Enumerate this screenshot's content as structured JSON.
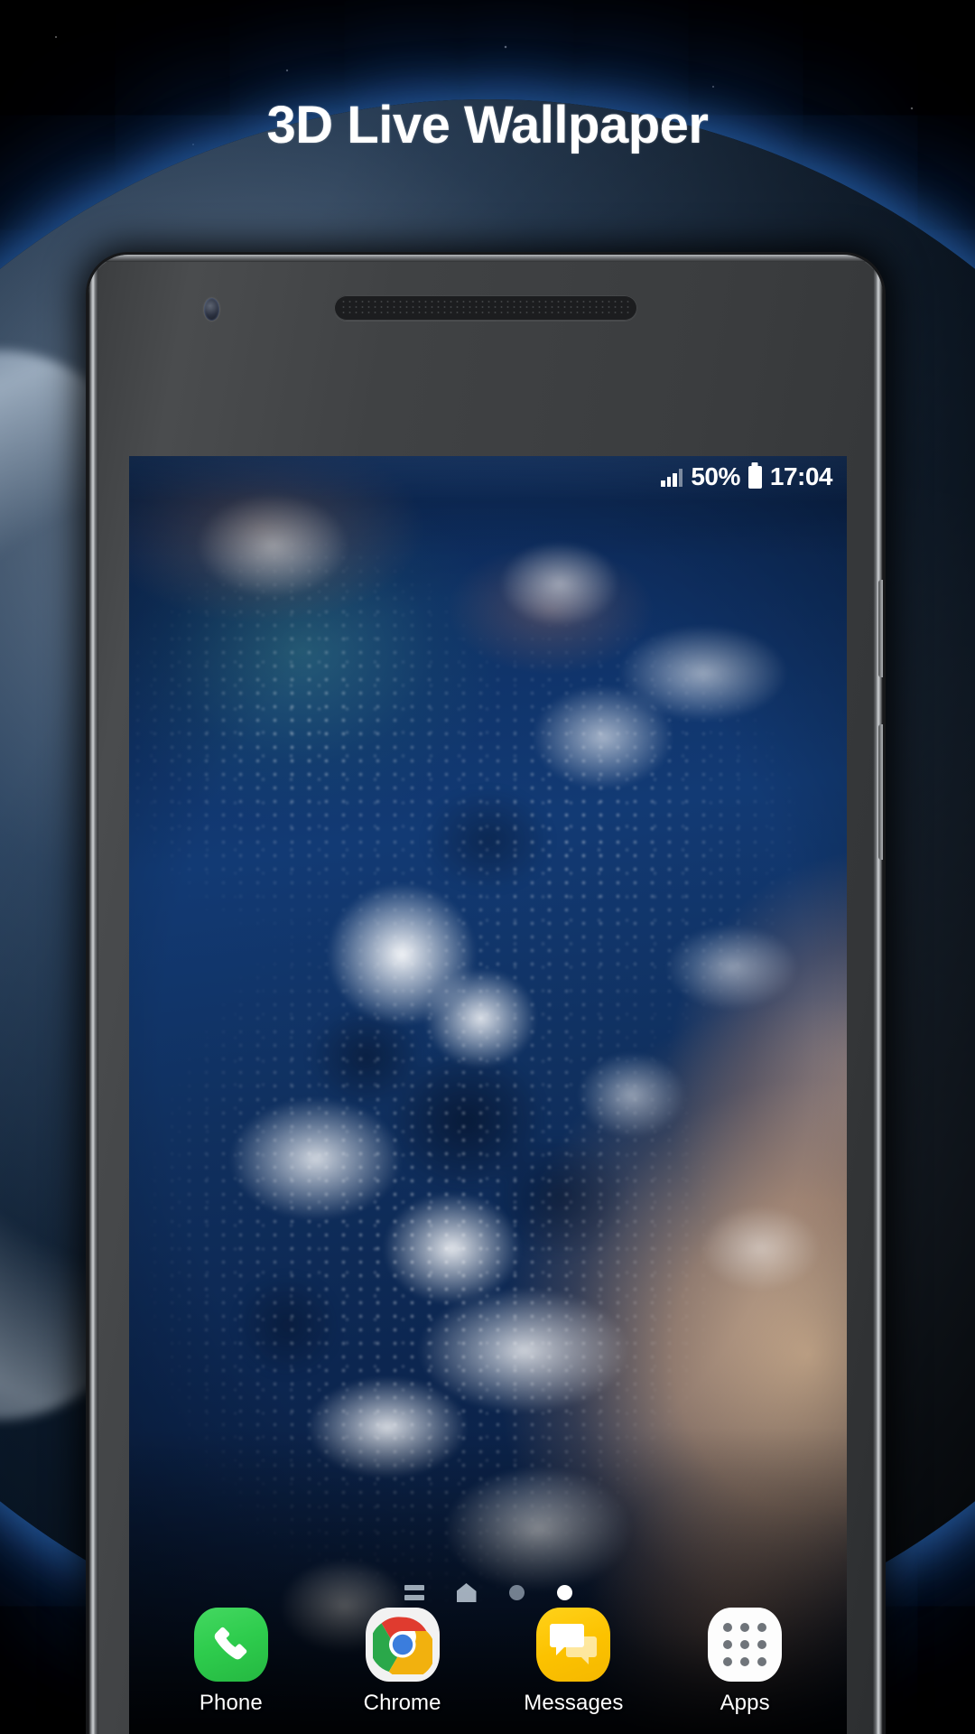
{
  "promo": {
    "headline": "3D Live Wallpaper",
    "background_scene": "earth-from-space",
    "colors": {
      "background": "#000000",
      "headline": "#ffffff",
      "atmosphere_glow": "#3c8ceb",
      "ocean": "#11356b",
      "landmass": "#dcba96"
    }
  },
  "device": {
    "type": "android-smartphone",
    "frame_color": "#3d3f41",
    "hardware": {
      "front_camera": "front-camera",
      "earpiece": "speaker-grill",
      "power_button": "power-button",
      "volume_button": "volume-button"
    }
  },
  "status_bar": {
    "signal_icon": "cellular-signal-icon",
    "signal_bars_filled": 3,
    "signal_bars_total": 4,
    "battery_percent": "50%",
    "battery_icon": "battery-icon",
    "time": "17:04"
  },
  "home_screen": {
    "wallpaper": "earth-live-wallpaper",
    "page_indicator": {
      "items": [
        {
          "name": "briefing-page-icon",
          "type": "briefing",
          "active": false
        },
        {
          "name": "home-page-icon",
          "type": "home",
          "active": false
        },
        {
          "name": "page-dot",
          "type": "dot",
          "active": false
        },
        {
          "name": "page-dot",
          "type": "dot",
          "active": true
        }
      ],
      "active_index": 3,
      "total_pages": 4
    },
    "dock": [
      {
        "label": "Phone",
        "icon": "phone-icon",
        "color": "#2ecc4d"
      },
      {
        "label": "Chrome",
        "icon": "chrome-icon",
        "color": "#f2f2f2"
      },
      {
        "label": "Messages",
        "icon": "messages-icon",
        "color": "#fcc200"
      },
      {
        "label": "Apps",
        "icon": "apps-grid-icon",
        "color": "#fdfdfd"
      }
    ]
  }
}
